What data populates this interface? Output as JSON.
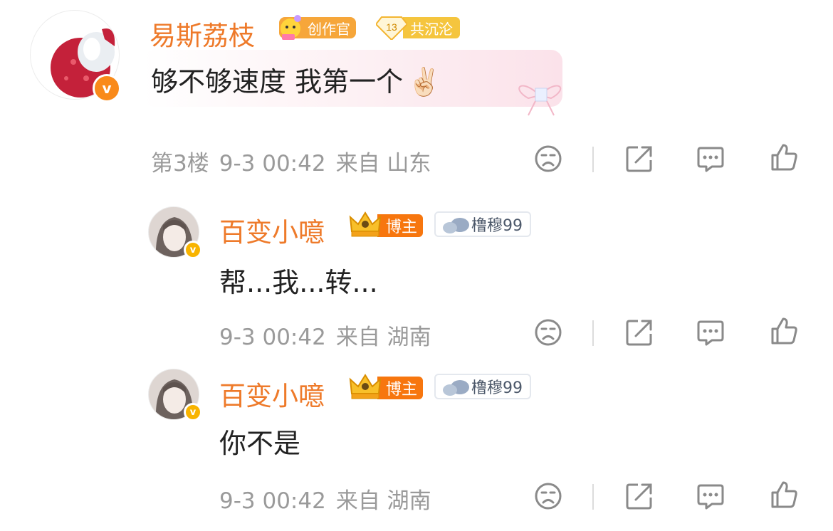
{
  "comments": [
    {
      "username": "易斯荔枝",
      "badge1_label": "创作官",
      "badge2_level": "13",
      "badge2_label": "共沉沦",
      "text": "够不够速度 我第一个",
      "emoji": "✌🏻",
      "floor": "第3楼",
      "time": "9-3 00:42",
      "location": "来自 山东",
      "verified_mark": "v"
    },
    {
      "username": "百变小噫",
      "badge1_label": "博主",
      "fan_label": "橹穆99",
      "text": "帮...我...转...",
      "time": "9-3 00:42",
      "location": "来自 湖南",
      "verified_mark": "v"
    },
    {
      "username": "百变小噫",
      "badge1_label": "博主",
      "fan_label": "橹穆99",
      "text": "你不是",
      "time": "9-3 00:42",
      "location": "来自 湖南",
      "verified_mark": "v"
    }
  ],
  "colors": {
    "username": "#ee7a2a",
    "meta": "#9a9a9a",
    "icon": "#8a8a8a",
    "creator_badge": "#f6a63a",
    "fan_badge_bg": "#fff2c8",
    "blogger_badge": "#f7760e",
    "verified_orange": "#f98a1a",
    "verified_yellow": "#f8b400"
  },
  "icons": [
    "emoji-reaction-icon",
    "share-icon",
    "comment-icon",
    "like-icon"
  ]
}
